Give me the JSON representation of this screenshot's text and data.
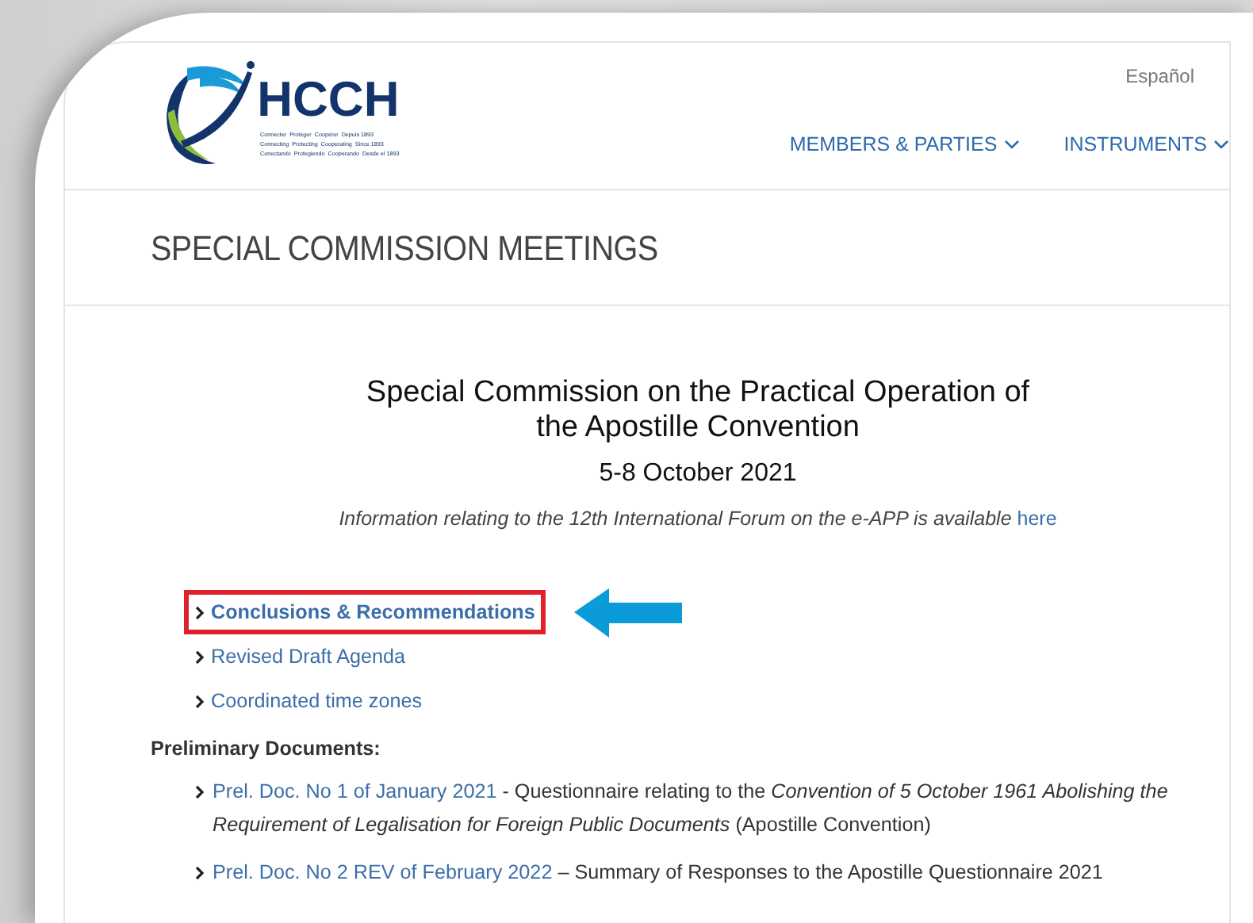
{
  "header": {
    "logo_text": "HCCH",
    "logo_taglines": [
      "Connecter  Protéger  Coopérer  Depuis 1893",
      "Connecting  Protecting  Cooperating  Since 1893",
      "Conectando  Protegiendo  Cooperando  Desde el 1893"
    ],
    "language_link": "Español",
    "nav": [
      {
        "label": "MEMBERS & PARTIES"
      },
      {
        "label": "INSTRUMENTS"
      }
    ]
  },
  "page_title": "SPECIAL COMMISSION MEETINGS",
  "content": {
    "heading": "Special Commission on the Practical Operation of the Apostille Convention",
    "date": "5-8 October 2021",
    "info": {
      "text": "Information relating to the 12th International Forum on the e-APP is available ",
      "link": "here"
    },
    "links": [
      {
        "label": "Conclusions & Recommendations",
        "highlighted": true
      },
      {
        "label": "Revised Draft Agenda",
        "highlighted": false
      },
      {
        "label": "Coordinated time zones",
        "highlighted": false
      }
    ],
    "documents_heading": "Preliminary Documents:",
    "documents": [
      {
        "link": "Prel. Doc. No 1 of January 2021",
        "description": " - Questionnaire relating to the *Convention of 5 October 1961 Abolishing the Requirement of Legalisation for Foreign Public Documents* (Apostille Convention)"
      },
      {
        "link": "Prel. Doc. No 2 REV of February 2022",
        "description": " – Summary of Responses to the Apostille Questionnaire 2021"
      }
    ]
  }
}
